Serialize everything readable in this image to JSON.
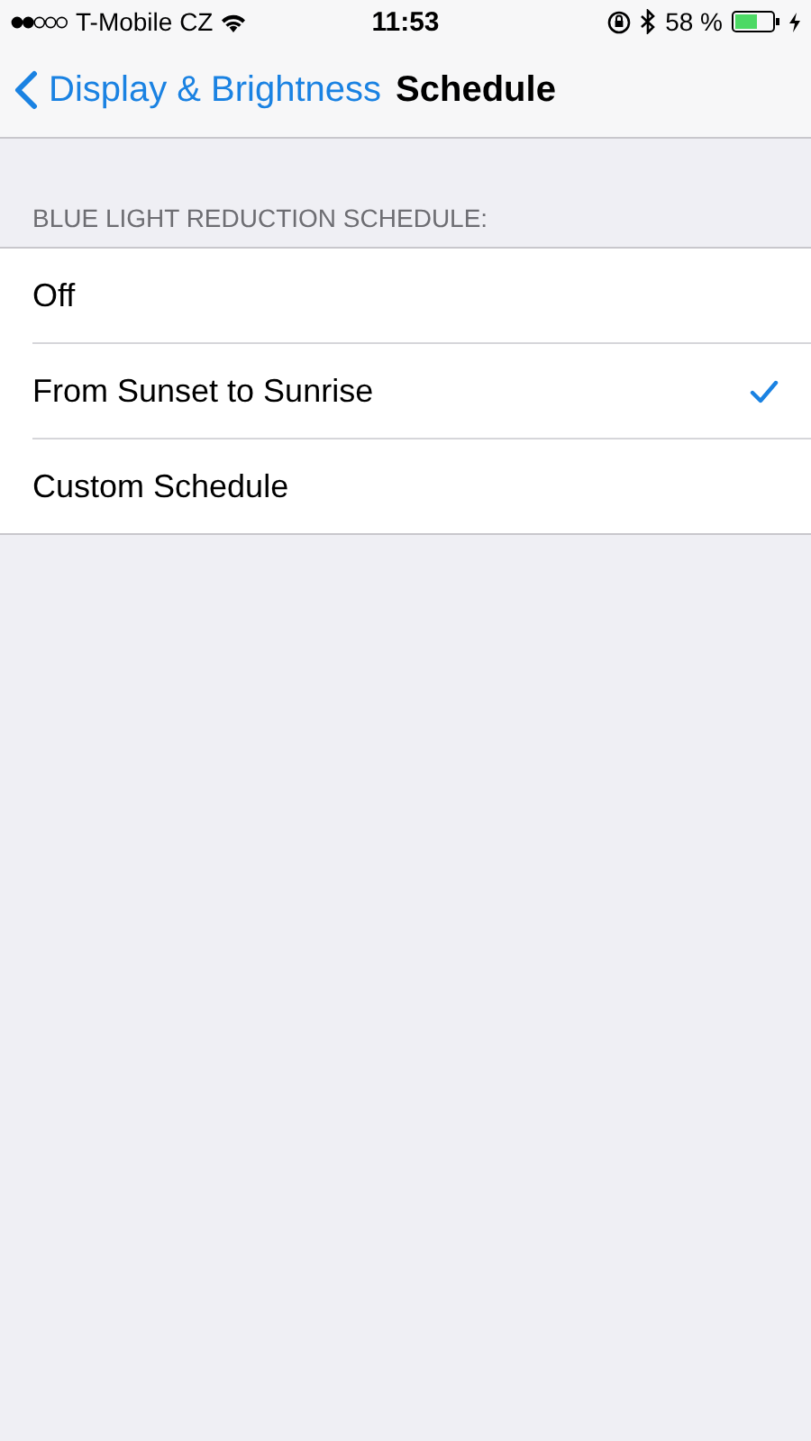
{
  "status_bar": {
    "carrier": "T-Mobile CZ",
    "time": "11:53",
    "battery": "58 %"
  },
  "nav": {
    "back": "Display & Brightness",
    "title": "Schedule"
  },
  "section": {
    "header": "BLUE LIGHT REDUCTION SCHEDULE:",
    "options": [
      {
        "label": "Off",
        "selected": false
      },
      {
        "label": "From Sunset to Sunrise",
        "selected": true
      },
      {
        "label": "Custom Schedule",
        "selected": false
      }
    ]
  }
}
